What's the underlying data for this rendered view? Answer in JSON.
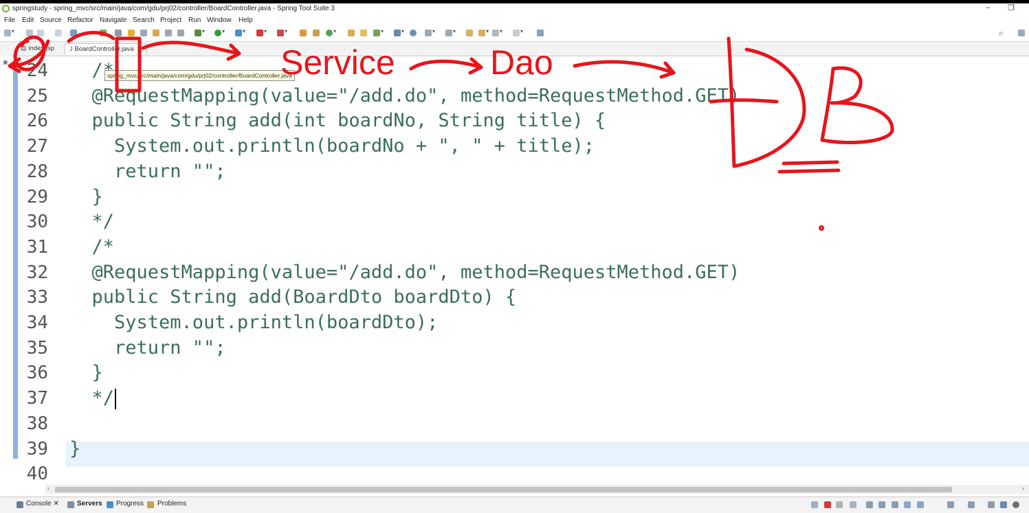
{
  "window": {
    "title": "springstudy - spring_mvc/src/main/java/com/gdu/prj02/controller/BoardController.java - Spring Tool Suite 3",
    "minimize": "–",
    "restore": "❐"
  },
  "menu": [
    "File",
    "Edit",
    "Source",
    "Refactor",
    "Navigate",
    "Search",
    "Project",
    "Run",
    "Window",
    "Help"
  ],
  "tabs": [
    {
      "label": "index.jsp",
      "icon": "jsp-file-icon"
    },
    {
      "label": "BoardController.java",
      "icon": "java-file-icon",
      "close": "✕"
    }
  ],
  "tooltip": "spring_mvc/src/main/java/com/gdu/prj02/controller/BoardController.java",
  "code": [
    {
      "n": "24",
      "t": "  /*"
    },
    {
      "n": "25",
      "t": "  @RequestMapping(value=\"/add.do\", method=RequestMethod.GET)"
    },
    {
      "n": "26",
      "t": "  public String add(int boardNo, String title) {"
    },
    {
      "n": "27",
      "t": "    System.out.println(boardNo + \", \" + title);"
    },
    {
      "n": "28",
      "t": "    return \"\";"
    },
    {
      "n": "29",
      "t": "  }"
    },
    {
      "n": "30",
      "t": "  */"
    },
    {
      "n": "31",
      "t": "  /*"
    },
    {
      "n": "32",
      "t": "  @RequestMapping(value=\"/add.do\", method=RequestMethod.GET)"
    },
    {
      "n": "33",
      "t": "  public String add(BoardDto boardDto) {"
    },
    {
      "n": "34",
      "t": "    System.out.println(boardDto);"
    },
    {
      "n": "35",
      "t": "    return \"\";"
    },
    {
      "n": "36",
      "t": "  }"
    },
    {
      "n": "37",
      "t": "  */"
    },
    {
      "n": "38",
      "t": ""
    },
    {
      "n": "39",
      "t": "}"
    },
    {
      "n": "40",
      "t": ""
    }
  ],
  "annotations": {
    "service": "Service",
    "dao": "Dao",
    "db": "DB",
    "color": "#e8141b"
  },
  "bottom_tabs": [
    "Console",
    "Servers",
    "Progress",
    "Problems"
  ],
  "colors": {
    "code_text": "#3b6e5a",
    "current_line": "#e8f2fe",
    "gutter_marker": "#8ab3e0"
  }
}
